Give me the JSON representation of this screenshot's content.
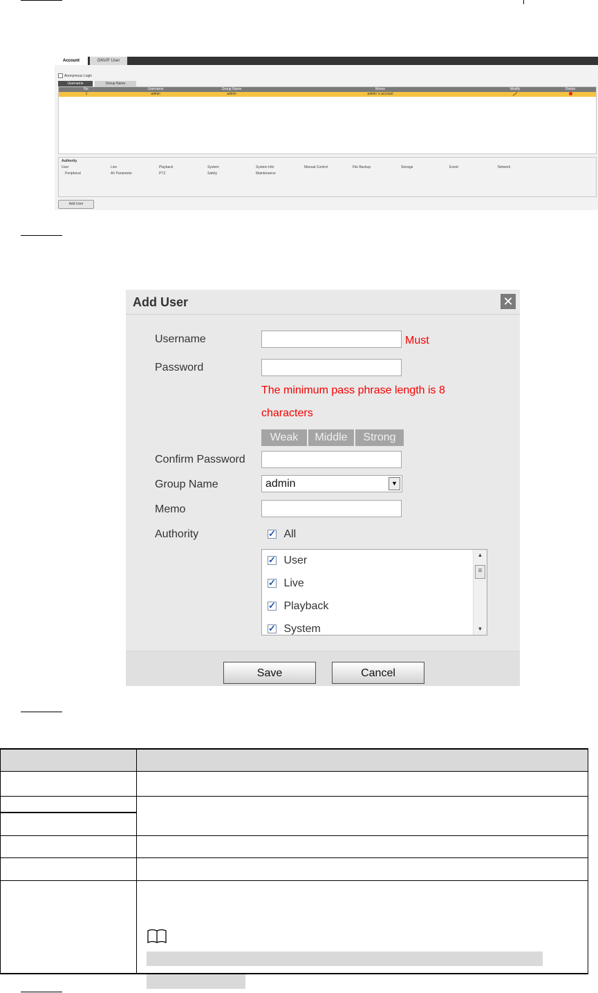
{
  "account_ui": {
    "tabs": [
      "Account",
      "ONVIF User"
    ],
    "anonymous_login_label": "Anonymous Login",
    "sub_tabs": [
      "Username",
      "Group Name"
    ],
    "table_headers": [
      "No.",
      "Username",
      "Group Name",
      "Memo",
      "Modify",
      "Delete"
    ],
    "row": {
      "no": "1",
      "username": "admin",
      "group_name": "admin",
      "memo": "admin 's account"
    },
    "authority_title": "Authority",
    "authority_row1": [
      "User",
      "Live",
      "Playback",
      "System",
      "System Info",
      "Manual Control",
      "File Backup",
      "Storage",
      "Event",
      "Network"
    ],
    "authority_row2": [
      "Peripheral",
      "AV Parameter",
      "PTZ",
      "Safety",
      "Maintenance"
    ],
    "add_user_button": "Add User"
  },
  "dialog": {
    "title": "Add User",
    "close_icon": "close-icon",
    "username_label": "Username",
    "must_text": "Must",
    "password_label": "Password",
    "password_hint_line1": "The minimum pass phrase length is 8",
    "password_hint_line2": "characters",
    "strength": [
      "Weak",
      "Middle",
      "Strong"
    ],
    "confirm_password_label": "Confirm Password",
    "group_name_label": "Group Name",
    "group_name_value": "admin",
    "memo_label": "Memo",
    "authority_label": "Authority",
    "all_label": "All",
    "authority_items": [
      "User",
      "Live",
      "Playback",
      "System"
    ],
    "save_button": "Save",
    "cancel_button": "Cancel"
  },
  "colors": {
    "highlight_row": "#f5c242",
    "warning_text": "#f50000",
    "table_header_bg": "#d9d9d9"
  }
}
